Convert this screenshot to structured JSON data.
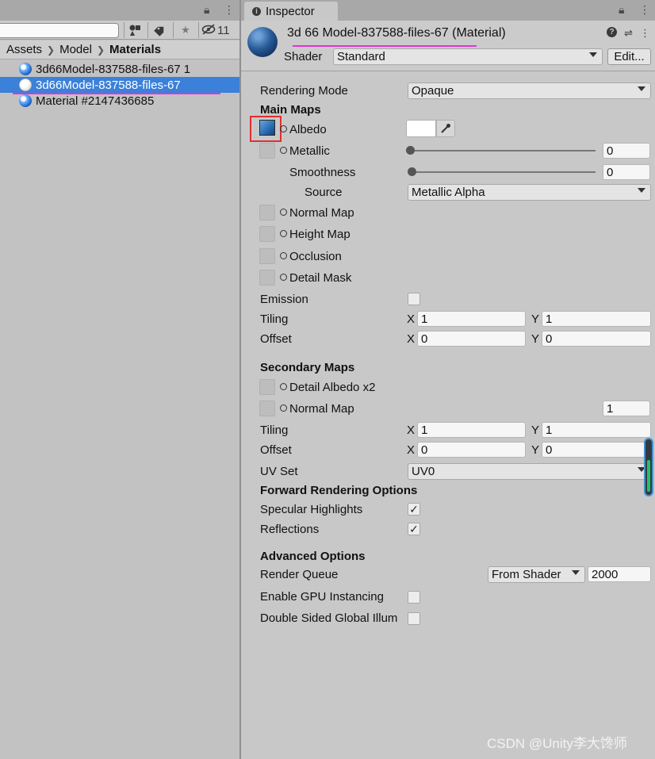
{
  "project": {
    "toolbar": {
      "search_value": "",
      "filter_icon": "filter-by-type-icon",
      "tag_icon": "label-icon",
      "star_icon": "favorite-star-icon",
      "hidden_icon": "eye-slash-icon",
      "hidden_count": "11"
    },
    "breadcrumb": [
      "Assets",
      "Model",
      "Materials"
    ],
    "assets": [
      {
        "name": "3d66Model-837588-files-67 1",
        "icon": "material-sphere-blue-icon"
      },
      {
        "name": "3d66Model-837588-files-67",
        "icon": "material-sphere-white-icon",
        "selected": true
      },
      {
        "name": "Material #2147436685",
        "icon": "material-sphere-blue-icon"
      }
    ]
  },
  "inspector": {
    "tab_label": "Inspector",
    "title": "3d 66 Model-837588-files-67 (Material)",
    "shader_label": "Shader",
    "shader_value": "Standard",
    "edit_label": "Edit...",
    "rendering_mode": {
      "label": "Rendering Mode",
      "value": "Opaque"
    },
    "main_maps": {
      "title": "Main Maps",
      "albedo": {
        "label": "Albedo",
        "color": "#ffffff"
      },
      "metallic": {
        "label": "Metallic",
        "value": "0",
        "level": 0
      },
      "smoothness": {
        "label": "Smoothness",
        "value": "0",
        "level": 0
      },
      "source": {
        "label": "Source",
        "value": "Metallic Alpha"
      },
      "normal_map": "Normal Map",
      "height_map": "Height Map",
      "occlusion": "Occlusion",
      "detail_mask": "Detail Mask",
      "emission": {
        "label": "Emission",
        "checked": false
      },
      "tiling": {
        "label": "Tiling",
        "x": "1",
        "y": "1"
      },
      "offset": {
        "label": "Offset",
        "x": "0",
        "y": "0"
      }
    },
    "secondary_maps": {
      "title": "Secondary Maps",
      "detail_albedo": "Detail Albedo x2",
      "normal_map": {
        "label": "Normal Map",
        "value": "1"
      },
      "tiling": {
        "label": "Tiling",
        "x": "1",
        "y": "1"
      },
      "offset": {
        "label": "Offset",
        "x": "0",
        "y": "0"
      },
      "uv_set": {
        "label": "UV Set",
        "value": "UV0"
      }
    },
    "forward": {
      "title": "Forward Rendering Options",
      "specular": {
        "label": "Specular Highlights",
        "checked": true
      },
      "reflections": {
        "label": "Reflections",
        "checked": true
      }
    },
    "advanced": {
      "title": "Advanced Options",
      "render_queue": {
        "label": "Render Queue",
        "mode": "From Shader",
        "value": "2000"
      },
      "gpu_instancing": {
        "label": "Enable GPU Instancing",
        "checked": false
      },
      "double_sided": {
        "label": "Double Sided Global Illum",
        "checked": false
      }
    },
    "axis_x": "X",
    "axis_y": "Y"
  },
  "watermark": "CSDN @Unity李大馋师",
  "colors": {
    "selection": "#3b80d9",
    "annotation_underline": "#e233d6",
    "annotation_box": "#e03030",
    "scroll_indicator": "#22c55e"
  }
}
